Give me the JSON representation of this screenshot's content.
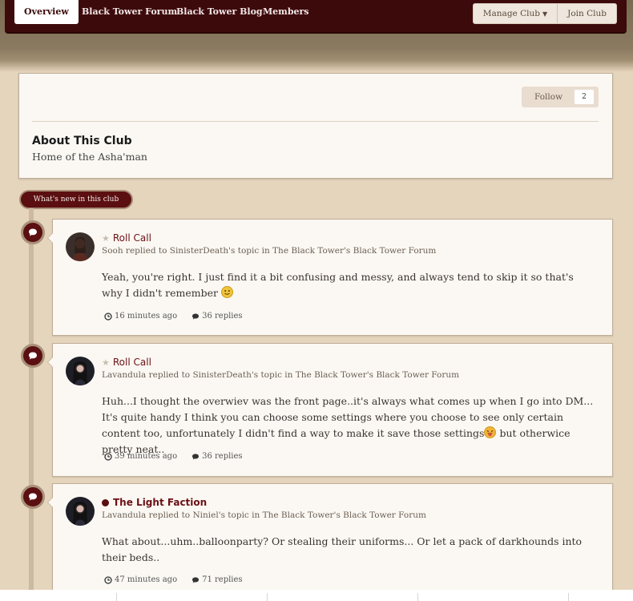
{
  "nav": {
    "tabs": [
      "Overview",
      "Black Tower Forum",
      "Black Tower Blog",
      "Members"
    ],
    "manage_label": "Manage Club",
    "join_label": "Join Club"
  },
  "about": {
    "follow_label": "Follow",
    "follow_count": "2",
    "title": "About This Club",
    "description": "Home of the Asha'man"
  },
  "whats_new_label": "What's new in this club",
  "activity": [
    {
      "title": "Roll Call",
      "title_marker": "star-icon",
      "subtitle": "Sooh replied to SinisterDeath's topic in The Black Tower's Black Tower Forum",
      "body": "Yeah, you're right. I just find it a bit confusing and messy, and always tend to skip it so that's why I didn't remember",
      "body_emoji": "slight-smile-emoji",
      "time": "16 minutes ago",
      "replies": "36 replies"
    },
    {
      "title": "Roll Call",
      "title_marker": "star-icon",
      "subtitle": "Lavandula replied to SinisterDeath's topic in The Black Tower's Black Tower Forum",
      "body_part1": "Huh...I thought the overwiev was the front page..it's always what comes up when I go into DM... It's quite handy I think you can choose some settings where you choose to see only certain content too, unfortunately I didn't find a way to make it save those settings",
      "body_part2": " but otherwice pretty neat..",
      "body_emoji": "tongue-out-emoji",
      "time": "39 minutes ago",
      "replies": "36 replies"
    },
    {
      "title": "The Light Faction",
      "title_marker": "unread-dot-icon",
      "subtitle": "Lavandula replied to Niniel's topic in The Black Tower's Black Tower Forum",
      "body": "What about...uhm..balloonparty? Or stealing their uniforms... Or let a pack of darkhounds into their beds..",
      "time": "47 minutes ago",
      "replies": "71 replies"
    }
  ],
  "colors": {
    "brand": "#3d0a0c",
    "accent": "#5b0f10",
    "link": "#6a1015",
    "background": "#e6d5bd"
  }
}
